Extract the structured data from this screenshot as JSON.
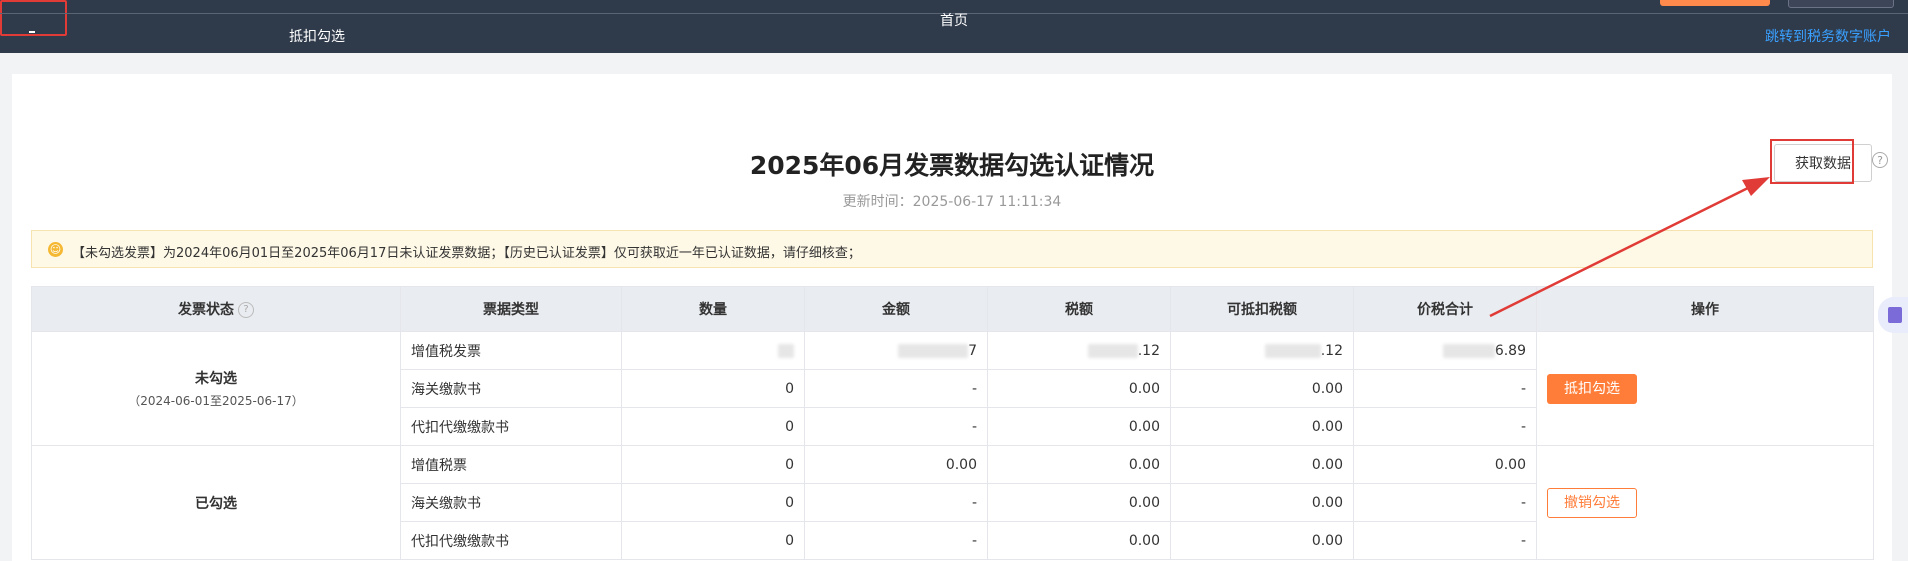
{
  "nav": {
    "home": "首页",
    "deduct_select": "抵扣勾选",
    "link_tax_account": "跳转到税务数字账户"
  },
  "header": {
    "title": "2025年06月发票数据勾选认证情况",
    "update_time": "更新时间：2025-06-17 11:11:34",
    "fetch_button": "获取数据",
    "help_icon": "?"
  },
  "notice": {
    "icon": "smile-icon",
    "text": "【未勾选发票】为2024年06月01日至2025年06月17日未认证发票数据；【历史已认证发票】仅可获取近一年已认证数据，请仔细核查；"
  },
  "table": {
    "columns": [
      "发票状态",
      "票据类型",
      "数量",
      "金额",
      "税额",
      "可抵扣税额",
      "价税合计",
      "操作"
    ],
    "groups": [
      {
        "status": "未勾选",
        "period": "（2024-06-01至2025-06-17）",
        "action": "抵扣勾选",
        "rows": [
          {
            "type": "增值税发票",
            "count": "",
            "amount": "7",
            "tax": ".12",
            "deductible": ".12",
            "total": "6.89"
          },
          {
            "type": "海关缴款书",
            "count": "0",
            "amount": "-",
            "tax": "0.00",
            "deductible": "0.00",
            "total": "-"
          },
          {
            "type": "代扣代缴缴款书",
            "count": "0",
            "amount": "-",
            "tax": "0.00",
            "deductible": "0.00",
            "total": "-"
          }
        ]
      },
      {
        "status": "已勾选",
        "period": "",
        "action": "撤销勾选",
        "rows": [
          {
            "type": "增值税票",
            "count": "0",
            "amount": "0.00",
            "tax": "0.00",
            "deductible": "0.00",
            "total": "0.00"
          },
          {
            "type": "海关缴款书",
            "count": "0",
            "amount": "-",
            "tax": "0.00",
            "deductible": "0.00",
            "total": "-"
          },
          {
            "type": "代扣代缴缴款书",
            "count": "0",
            "amount": "-",
            "tax": "0.00",
            "deductible": "0.00",
            "total": "-"
          }
        ]
      }
    ]
  },
  "colors": {
    "topbar": "#2f3a4b",
    "accent": "#ff7d39",
    "annotation": "#e03b36",
    "link": "#3aa0ff"
  }
}
